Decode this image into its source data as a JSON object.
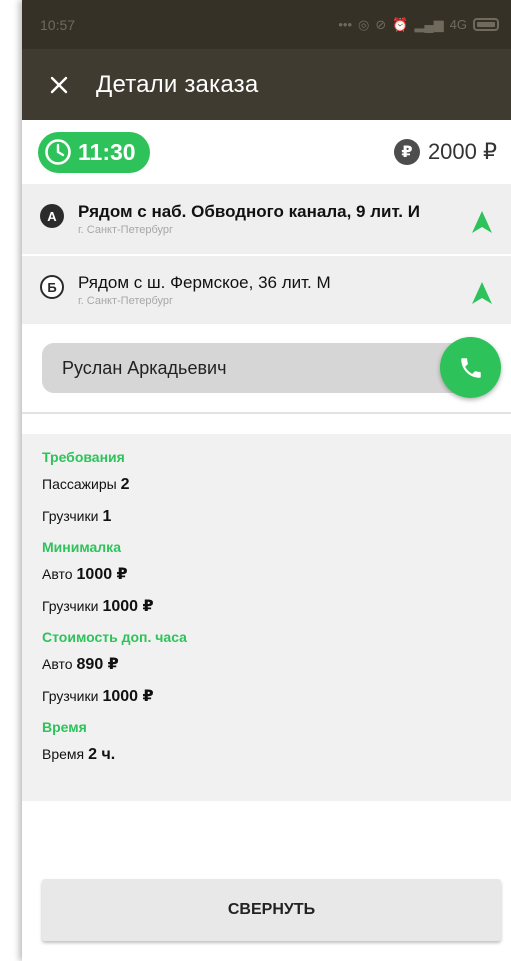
{
  "status_bar": {
    "time": "10:57",
    "network": "4G",
    "icons": [
      "dots-icon",
      "data-saver-icon",
      "mute-icon",
      "alarm-icon",
      "signal-icon",
      "battery-icon"
    ]
  },
  "app_bar": {
    "title": "Детали заказа",
    "close_icon": "close-icon"
  },
  "summary": {
    "time": "11:30",
    "price": "2000 ₽",
    "currency_symbol": "₽"
  },
  "route": [
    {
      "marker": "А",
      "address": "Рядом с наб. Обводного канала, 9 лит. И",
      "city": "г. Санкт-Петербург"
    },
    {
      "marker": "Б",
      "address": "Рядом с ш. Фермское, 36 лит. М",
      "city": "г. Санкт-Петербург"
    }
  ],
  "contact": {
    "name": "Руслан Аркадьевич",
    "call_icon": "phone-icon"
  },
  "details": {
    "requirements": {
      "title": "Требования",
      "passengers_label": "Пассажиры",
      "passengers_value": "2",
      "loaders_label": "Грузчики",
      "loaders_value": "1"
    },
    "minimum": {
      "title": "Минималка",
      "car_label": "Авто",
      "car_value": "1000 ₽",
      "loaders_label": "Грузчики",
      "loaders_value": "1000 ₽"
    },
    "extra_hour": {
      "title": "Стоимость доп. часа",
      "car_label": "Авто",
      "car_value": "890 ₽",
      "loaders_label": "Грузчики",
      "loaders_value": "1000 ₽"
    },
    "time": {
      "title": "Время",
      "label": "Время",
      "value": "2 ч."
    }
  },
  "collapse_button": "СВЕРНУТЬ",
  "colors": {
    "accent": "#2ec35a",
    "app_bar": "#403b30",
    "status_bar": "#353126"
  }
}
